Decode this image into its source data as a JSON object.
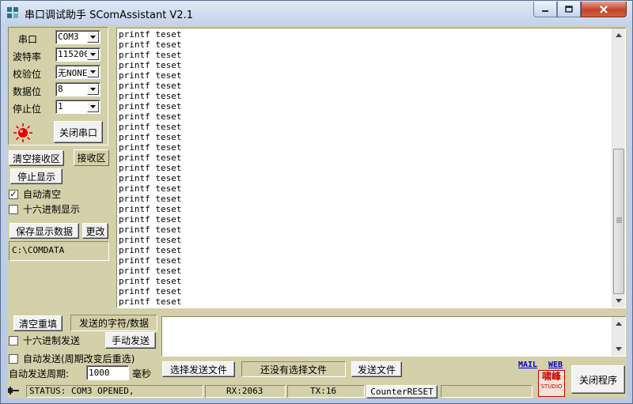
{
  "window": {
    "title": "串口调试助手 SComAssistant V2.1"
  },
  "serial": {
    "port_label": "串口",
    "port_value": "COM3",
    "baud_label": "波特率",
    "baud_value": "115200",
    "parity_label": "校验位",
    "parity_value": "无NONE",
    "databits_label": "数据位",
    "databits_value": "8",
    "stopbits_label": "停止位",
    "stopbits_value": "1",
    "open_button": "关闭串口",
    "status_led_color": "#e60000"
  },
  "receive": {
    "clear_button": "清空接收区",
    "area_label": "接收区",
    "stop_display_button": "停止显示",
    "auto_clear_label": "自动清空",
    "auto_clear_checked": true,
    "hex_display_label": "十六进制显示",
    "hex_display_checked": false,
    "save_button": "保存显示数据",
    "change_button": "更改",
    "save_path": "C:\\COMDATA",
    "lines": [
      "printf teset",
      "printf teset",
      "printf teset",
      "printf teset",
      "printf teset",
      "printf teset",
      "printf teset",
      "printf teset",
      "printf teset",
      "printf teset",
      "printf teset",
      "printf teset",
      "printf teset",
      "printf teset",
      "printf teset",
      "printf teset",
      "printf teset",
      "printf teset",
      "printf teset",
      "printf teset",
      "printf teset",
      "printf teset",
      "printf teset",
      "printf teset",
      "printf teset",
      "printf teset",
      "printf teset"
    ]
  },
  "send": {
    "clear_resend_button": "清空重填",
    "area_label": "发送的字符/数据",
    "hex_send_label": "十六进制发送",
    "hex_send_checked": false,
    "manual_send_button": "手动发送",
    "auto_send_label": "自动发送(周期改变后重选)",
    "auto_send_checked": false,
    "period_label": "自动发送周期:",
    "period_value": "1000",
    "period_unit": "毫秒",
    "select_file_button": "选择发送文件",
    "file_status": "还没有选择文件",
    "send_file_button": "发送文件",
    "close_program_button": "关闭程序"
  },
  "links": {
    "mail": "MAIL",
    "web": "WEB"
  },
  "logo": {
    "line1": "啸峰",
    "line2": "STUDIO"
  },
  "statusbar": {
    "status": "STATUS: COM3 OPENED,",
    "rx": "RX:2063",
    "tx": "TX:16",
    "counter_reset": "CounterRESET"
  }
}
